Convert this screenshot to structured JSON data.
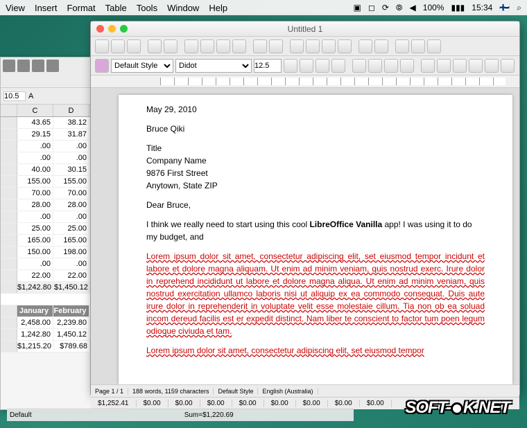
{
  "menubar": {
    "items": [
      "View",
      "Insert",
      "Format",
      "Table",
      "Tools",
      "Window",
      "Help"
    ],
    "battery": "100%",
    "time": "15:34"
  },
  "writer": {
    "title": "Untitled 1",
    "style": "Default Style",
    "font": "Didot",
    "size": "12.5",
    "document": {
      "date": "May 29, 2010",
      "name": "Bruce Qiki",
      "title_line": "Title",
      "company": "Company Name",
      "street": "9876 First Street",
      "city": "Anytown, State ZIP",
      "salutation": "Dear Bruce,",
      "para1_a": "I think we really need to start using this cool ",
      "para1_b": "LibreOffice Vanilla",
      "para1_c": " app! I was using it to do my budget, and",
      "lorem1": "Lorem ipsum dolor sit amet, consectetur adipiscing elit, set eiusmod tempor incidunt et labore et dolore magna aliquam. Ut enim ad minim veniam, quis nostrud exerc. Irure dolor in reprehend incididunt ut labore et dolore magna aliqua. Ut enim ad minim veniam, quis nostrud exercitation ullamco laboris nisi ut aliquip ex ea commodo consequat. Duis aute irure dolor in reprehenderit in voluptate velit esse molestaie cillum. Tia non ob ea soluad incom dereud facilis est er expedit distinct. Nam liber te conscient to factor tum poen legum odioque civiuda et tam.",
      "lorem2": "Lorem ipsum dolor sit amet, consectetur adipiscing elit, set eiusmod tempor"
    },
    "status": {
      "page": "Page 1 / 1",
      "words": "188 words, 1159 characters",
      "style": "Default Style",
      "lang": "English (Australia)"
    },
    "sums": [
      "$1,252.41",
      "$0.00",
      "$0.00",
      "$0.00",
      "$0.00",
      "$0.00",
      "$0.00",
      "$0.00",
      "$0.00"
    ]
  },
  "calc": {
    "font_size": "10.5",
    "col_headers": [
      "C",
      "D"
    ],
    "rows": [
      [
        "43.65",
        "38.12"
      ],
      [
        "29.15",
        "31.87"
      ],
      [
        ".00",
        ".00"
      ],
      [
        ".00",
        ".00"
      ],
      [
        "40.00",
        "30.15"
      ],
      [
        "155.00",
        "155.00"
      ],
      [
        "70.00",
        "70.00"
      ],
      [
        "28.00",
        "28.00"
      ],
      [
        ".00",
        ".00"
      ],
      [
        "25.00",
        "25.00"
      ],
      [
        "165.00",
        "165.00"
      ],
      [
        "150.00",
        "198.00"
      ],
      [
        ".00",
        ".00"
      ],
      [
        "22.00",
        "22.00"
      ]
    ],
    "total_row": [
      "$1,242.80",
      "$1,450.12"
    ],
    "month_headers": [
      "January",
      "February"
    ],
    "summary_rows": [
      [
        "2,458.00",
        "2,239.80"
      ],
      [
        "1,242.80",
        "1,450.12"
      ],
      [
        "$1,215.20",
        "$789.68"
      ]
    ],
    "status": {
      "default": "Default",
      "sum": "Sum=$1,220.69"
    }
  },
  "watermark": {
    "a": "SOFT-",
    "b": "K",
    "c": ".NET"
  }
}
